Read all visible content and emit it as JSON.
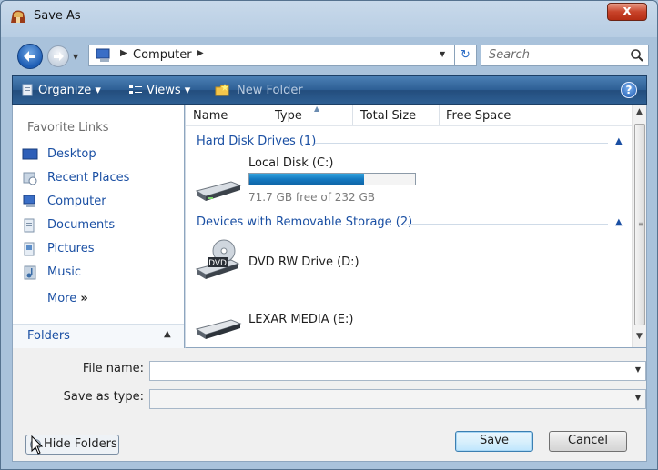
{
  "window": {
    "title": "Save As",
    "close_glyph": "x"
  },
  "address": {
    "location": "Computer",
    "search_placeholder": "Search"
  },
  "toolbar": {
    "organize": "Organize",
    "views": "Views",
    "new_folder": "New Folder",
    "help": "?"
  },
  "nav_pane": {
    "header": "Favorite Links",
    "items": [
      {
        "label": "Desktop",
        "icon": "desktop-icon"
      },
      {
        "label": "Recent Places",
        "icon": "recent-places-icon"
      },
      {
        "label": "Computer",
        "icon": "computer-icon"
      },
      {
        "label": "Documents",
        "icon": "documents-icon"
      },
      {
        "label": "Pictures",
        "icon": "pictures-icon"
      },
      {
        "label": "Music",
        "icon": "music-icon"
      }
    ],
    "more": "More",
    "folders": "Folders"
  },
  "columns": [
    "Name",
    "Type",
    "Total Size",
    "Free Space"
  ],
  "groups": {
    "hard_disks": {
      "header": "Hard Disk Drives (1)",
      "drives": [
        {
          "name": "Local Disk (C:)",
          "free_text": "71.7 GB free of 232 GB",
          "used_fraction": 0.69
        }
      ]
    },
    "removable": {
      "header": "Devices with Removable Storage (2)",
      "drives": [
        {
          "name": "DVD RW Drive (D:)",
          "badge": "DVD"
        },
        {
          "name": "LEXAR MEDIA (E:)"
        }
      ]
    }
  },
  "form": {
    "file_name_label": "File name:",
    "file_name_value": "",
    "save_type_label": "Save as type:",
    "save_type_value": ""
  },
  "buttons": {
    "hide_folders": "Hide Folders",
    "save": "Save",
    "cancel": "Cancel"
  }
}
